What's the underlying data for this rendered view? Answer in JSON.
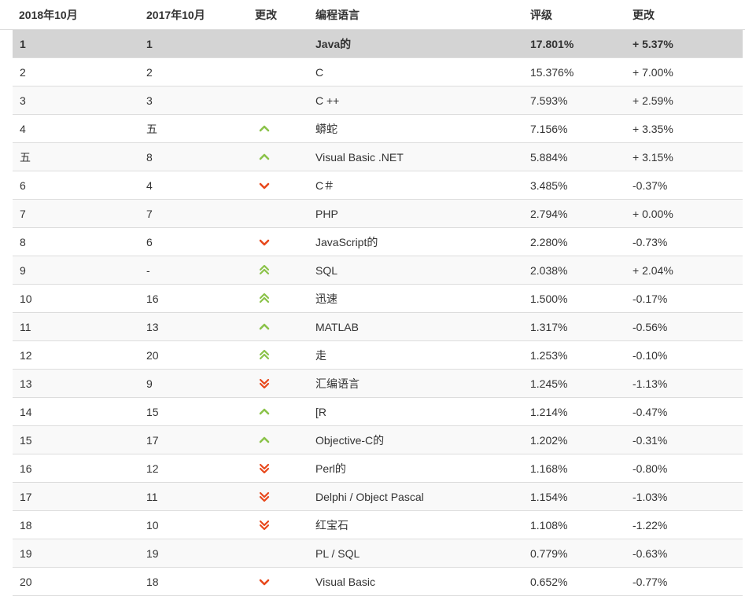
{
  "header": {
    "col_oct2018": "2018年10月",
    "col_oct2017": "2017年10月",
    "col_change": "更改",
    "col_language": "编程语言",
    "col_rating": "评级",
    "col_rating_change": "更改"
  },
  "colors": {
    "up": "#8bc34a",
    "down": "#e8491d",
    "highlight_row": "#d4d4d4",
    "stripe_row": "#f9f9f9"
  },
  "rows": [
    {
      "rank2018": "1",
      "rank2017": "1",
      "trend": "none",
      "language": "Java的",
      "rating": "17.801%",
      "change": "+ 5.37%"
    },
    {
      "rank2018": "2",
      "rank2017": "2",
      "trend": "none",
      "language": "C",
      "rating": "15.376%",
      "change": "+ 7.00%"
    },
    {
      "rank2018": "3",
      "rank2017": "3",
      "trend": "none",
      "language": "C ++",
      "rating": "7.593%",
      "change": "+ 2.59%"
    },
    {
      "rank2018": "4",
      "rank2017": "五",
      "trend": "up",
      "language": "蟒蛇",
      "rating": "7.156%",
      "change": "+ 3.35%"
    },
    {
      "rank2018": "五",
      "rank2017": "8",
      "trend": "up",
      "language": "Visual Basic .NET",
      "rating": "5.884%",
      "change": "+ 3.15%"
    },
    {
      "rank2018": "6",
      "rank2017": "4",
      "trend": "down",
      "language": "C＃",
      "rating": "3.485%",
      "change": "-0.37%"
    },
    {
      "rank2018": "7",
      "rank2017": "7",
      "trend": "none",
      "language": "PHP",
      "rating": "2.794%",
      "change": "+ 0.00%"
    },
    {
      "rank2018": "8",
      "rank2017": "6",
      "trend": "down",
      "language": "JavaScript的",
      "rating": "2.280%",
      "change": "-0.73%"
    },
    {
      "rank2018": "9",
      "rank2017": "-",
      "trend": "up2",
      "language": "SQL",
      "rating": "2.038%",
      "change": "+ 2.04%"
    },
    {
      "rank2018": "10",
      "rank2017": "16",
      "trend": "up2",
      "language": "迅速",
      "rating": "1.500%",
      "change": "-0.17%"
    },
    {
      "rank2018": "11",
      "rank2017": "13",
      "trend": "up",
      "language": "MATLAB",
      "rating": "1.317%",
      "change": "-0.56%"
    },
    {
      "rank2018": "12",
      "rank2017": "20",
      "trend": "up2",
      "language": "走",
      "rating": "1.253%",
      "change": "-0.10%"
    },
    {
      "rank2018": "13",
      "rank2017": "9",
      "trend": "down2",
      "language": "汇编语言",
      "rating": "1.245%",
      "change": "-1.13%"
    },
    {
      "rank2018": "14",
      "rank2017": "15",
      "trend": "up",
      "language": "[R",
      "rating": "1.214%",
      "change": "-0.47%"
    },
    {
      "rank2018": "15",
      "rank2017": "17",
      "trend": "up",
      "language": "Objective-C的",
      "rating": "1.202%",
      "change": "-0.31%"
    },
    {
      "rank2018": "16",
      "rank2017": "12",
      "trend": "down2",
      "language": "Perl的",
      "rating": "1.168%",
      "change": "-0.80%"
    },
    {
      "rank2018": "17",
      "rank2017": "11",
      "trend": "down2",
      "language": "Delphi / Object Pascal",
      "rating": "1.154%",
      "change": "-1.03%"
    },
    {
      "rank2018": "18",
      "rank2017": "10",
      "trend": "down2",
      "language": "红宝石",
      "rating": "1.108%",
      "change": "-1.22%"
    },
    {
      "rank2018": "19",
      "rank2017": "19",
      "trend": "none",
      "language": "PL / SQL",
      "rating": "0.779%",
      "change": "-0.63%"
    },
    {
      "rank2018": "20",
      "rank2017": "18",
      "trend": "down",
      "language": "Visual Basic",
      "rating": "0.652%",
      "change": "-0.77%"
    }
  ]
}
